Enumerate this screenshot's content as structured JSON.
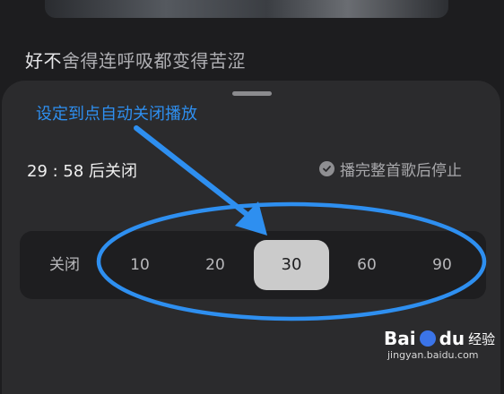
{
  "lyric": {
    "bright_part": "好不",
    "dim_part": "舍得连呼吸都变得苦涩"
  },
  "annotation": {
    "text": "设定到点自动关闭播放",
    "color": "#2e8ff0"
  },
  "timer": {
    "countdown": "29 : 58 后关闭"
  },
  "finish_option": {
    "label": "播完整首歌后停止"
  },
  "timer_options": {
    "off": "关闭",
    "opt_10": "10",
    "opt_20": "20",
    "opt_30": "30",
    "opt_60": "60",
    "opt_90": "90",
    "selected": "30"
  },
  "watermark": {
    "brand_bai": "Bai",
    "brand_du": "du",
    "jingyan": "经验",
    "url": "jingyan.baidu.com"
  },
  "icons": [
    "check-circle-icon",
    "drag-handle-icon",
    "annotation-arrow-icon",
    "annotation-ellipse-icon",
    "baidu-paw-icon"
  ]
}
